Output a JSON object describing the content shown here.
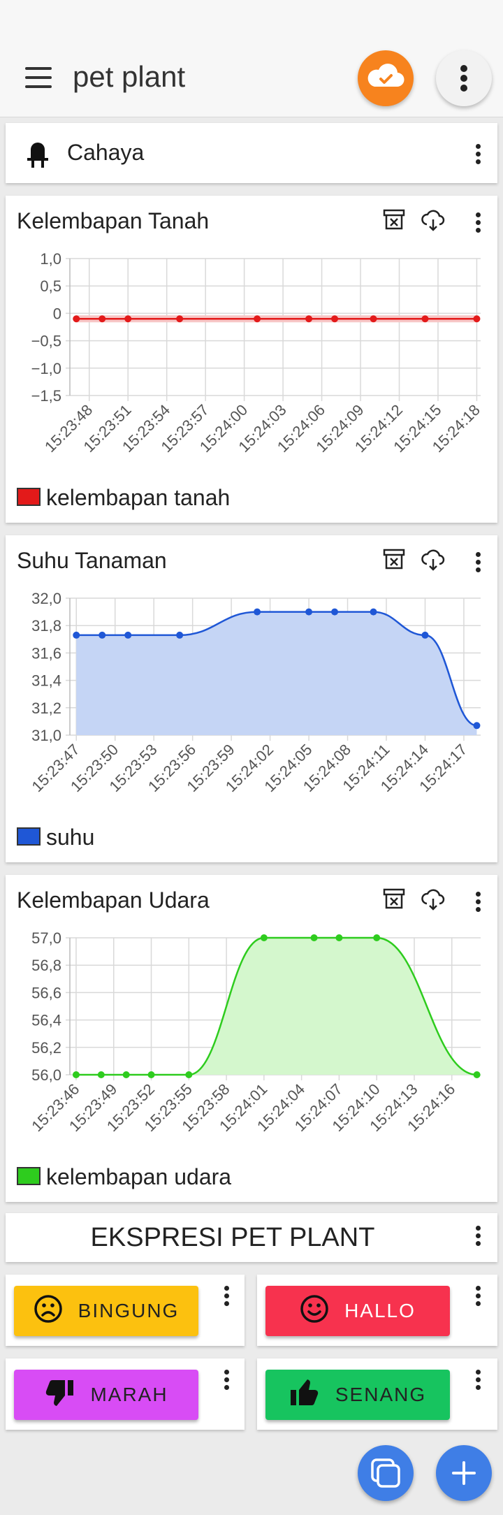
{
  "header": {
    "title": "pet plant",
    "cloud_status_icon": "cloud-check-icon",
    "more_icon": "more-vert-icon"
  },
  "cahaya_card": {
    "icon": "led-icon",
    "title": "Cahaya"
  },
  "charts": [
    {
      "title": "Kelembapan Tanah",
      "legend": "kelembapan tanah",
      "color": "#e31a1a",
      "fill": "#f7c6c6"
    },
    {
      "title": "Suhu Tanaman",
      "legend": "suhu",
      "color": "#1f57d6",
      "fill": "#c5d5f5"
    },
    {
      "title": "Kelembapan Udara",
      "legend": "kelembapan udara",
      "color": "#2ecc1e",
      "fill": "#d4f7cd"
    }
  ],
  "chart_data": [
    {
      "type": "line",
      "title": "Kelembapan Tanah",
      "x_ticks": [
        "15:23:48",
        "15:23:51",
        "15:23:54",
        "15:23:57",
        "15:24:00",
        "15:24:03",
        "15:24:06",
        "15:24:09",
        "15:24:12",
        "15:24:15",
        "15:24:18"
      ],
      "y_ticks": [
        "1,0",
        "0,5",
        "0",
        "−0,5",
        "−1,0",
        "−1,5"
      ],
      "ylim": [
        -1.5,
        1.0
      ],
      "grid": true,
      "legend_position": "bottom-left",
      "series": [
        {
          "name": "kelembapan tanah",
          "x": [
            "15:23:47",
            "15:23:49",
            "15:23:51",
            "15:23:55",
            "15:24:01",
            "15:24:05",
            "15:24:07",
            "15:24:10",
            "15:24:14",
            "15:24:18"
          ],
          "y": [
            -0.1,
            -0.1,
            -0.1,
            -0.1,
            -0.1,
            -0.1,
            -0.1,
            -0.1,
            -0.1,
            -0.1
          ]
        }
      ]
    },
    {
      "type": "area",
      "title": "Suhu Tanaman",
      "x_ticks": [
        "15:23:47",
        "15:23:50",
        "15:23:53",
        "15:23:56",
        "15:23:59",
        "15:24:02",
        "15:24:05",
        "15:24:08",
        "15:24:11",
        "15:24:14",
        "15:24:17"
      ],
      "y_ticks": [
        "32,0",
        "31,8",
        "31,6",
        "31,4",
        "31,2",
        "31,0"
      ],
      "ylim": [
        31.0,
        32.0
      ],
      "grid": true,
      "legend_position": "bottom-left",
      "series": [
        {
          "name": "suhu",
          "x": [
            "15:23:47",
            "15:23:49",
            "15:23:51",
            "15:23:55",
            "15:24:01",
            "15:24:05",
            "15:24:07",
            "15:24:10",
            "15:24:14",
            "15:24:18"
          ],
          "y": [
            31.73,
            31.73,
            31.73,
            31.73,
            31.9,
            31.9,
            31.9,
            31.9,
            31.73,
            31.07
          ]
        }
      ]
    },
    {
      "type": "area",
      "title": "Kelembapan Udara",
      "x_ticks": [
        "15:23:46",
        "15:23:49",
        "15:23:52",
        "15:23:55",
        "15:23:58",
        "15:24:01",
        "15:24:04",
        "15:24:07",
        "15:24:10",
        "15:24:13",
        "15:24:16"
      ],
      "y_ticks": [
        "57,0",
        "56,8",
        "56,6",
        "56,4",
        "56,2",
        "56,0"
      ],
      "ylim": [
        56.0,
        57.0
      ],
      "grid": true,
      "legend_position": "bottom-left",
      "series": [
        {
          "name": "kelembapan udara",
          "x": [
            "15:23:46",
            "15:23:48",
            "15:23:50",
            "15:23:52",
            "15:23:55",
            "15:24:01",
            "15:24:05",
            "15:24:07",
            "15:24:10",
            "15:24:18"
          ],
          "y": [
            56.0,
            56.0,
            56.0,
            56.0,
            56.0,
            57.0,
            57.0,
            57.0,
            57.0,
            56.0
          ]
        }
      ]
    }
  ],
  "expression": {
    "title": "EKSPRESI PET PLANT",
    "buttons": [
      {
        "label": "BINGUNG",
        "icon": "frown-face-icon",
        "color": "#fcc10f"
      },
      {
        "label": "HALLO",
        "icon": "smile-face-icon",
        "color": "#f7324e"
      },
      {
        "label": "MARAH",
        "icon": "thumbs-down-icon",
        "color": "#d84cf5"
      },
      {
        "label": "SENANG",
        "icon": "thumbs-up-icon",
        "color": "#17c45f"
      }
    ]
  },
  "fabs": {
    "copy_icon": "copy-icon",
    "add_icon": "plus-icon"
  }
}
